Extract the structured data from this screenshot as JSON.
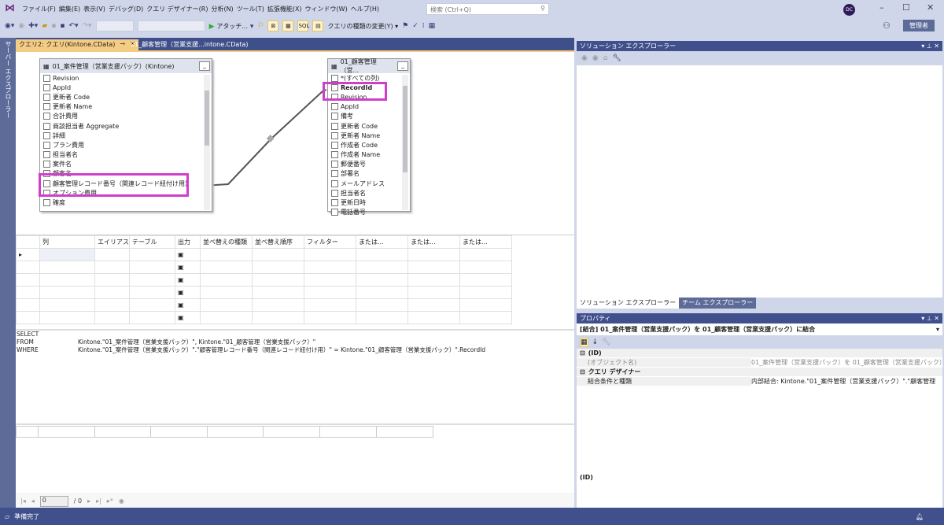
{
  "menu": [
    "ファイル(F)",
    "編集(E)",
    "表示(V)",
    "デバッグ(D)",
    "クエリ デザイナー(R)",
    "分析(N)",
    "ツール(T)",
    "拡張機能(X)",
    "ウィンドウ(W)",
    "ヘルプ(H)"
  ],
  "search_placeholder": "検索 (Ctrl+Q)",
  "toolbar": {
    "attach": "アタッチ...",
    "change_type": "クエリの種類の変更(Y)",
    "sql": "SQL"
  },
  "user_initials": "DC",
  "admin_label": "管理者",
  "side_panel": "サーバー エクスプローラー",
  "tabs": [
    {
      "label": "クエリ2: クエリ(Kintone.CData)"
    },
    {
      "label": "01_顧客管理（営業支援...intone.CData)"
    }
  ],
  "table1": {
    "title": "01_案件管理（営業支援パック）(Kintone)",
    "columns": [
      "Revision",
      "AppId",
      "更新者 Code",
      "更新者 Name",
      "合計費用",
      "商談担当者 Aggregate",
      "詳細",
      "プラン費用",
      "担当者名",
      "案件名",
      "顧客名",
      "顧客管理レコード番号（関連レコード紐付け用）",
      "オプション費用",
      "確度"
    ]
  },
  "table2": {
    "title": "01_顧客管理（営...",
    "columns": [
      "*(すべての列)",
      "RecordId",
      "Revision",
      "AppId",
      "備考",
      "更新者 Code",
      "更新者 Name",
      "作成者 Code",
      "作成者 Name",
      "郵便番号",
      "部署名",
      "メールアドレス",
      "担当者名",
      "更新日時",
      "電話番号"
    ]
  },
  "grid": {
    "headers": [
      "",
      "列",
      "エイリアス",
      "テーブル",
      "出力",
      "並べ替えの種類",
      "並べ替え順序",
      "フィルター",
      "または...",
      "または...",
      "または..."
    ],
    "rows": 6
  },
  "sql": [
    {
      "kw": "SELECT",
      "text": ""
    },
    {
      "kw": "FROM",
      "text": "Kintone.\"01_案件管理（営業支援パック）\", Kintone.\"01_顧客管理（営業支援パック）\""
    },
    {
      "kw": "WHERE",
      "text": "Kintone.\"01_案件管理（営業支援パック）\".\"顧客管理レコード番号（関連レコード紐付け用）\" = Kintone.\"01_顧客管理（営業支援パック）\".RecordId"
    }
  ],
  "nav": {
    "page": "0",
    "total": "/ 0"
  },
  "status": "準備完了",
  "solution_explorer": {
    "title": "ソリューション エクスプローラー",
    "tabs": [
      "ソリューション エクスプローラー",
      "チーム エクスプローラー"
    ]
  },
  "properties": {
    "title": "プロパティ",
    "selected": "[結合] 01_案件管理（営業支援パック）を 01_顧客管理（営業支援パック）に結合",
    "cat1": "(ID)",
    "row1_key": "(オブジェクト名)",
    "row1_val": "01_案件管理（営業支援パック）を 01_顧客管理（営業支援パック）",
    "cat2": "クエリ デザイナー",
    "row2_key": "結合条件と種類",
    "row2_val": "内部結合: Kintone.\"01_案件管理（営業支援パック）\".\"顧客管理",
    "footer": "(ID)"
  }
}
